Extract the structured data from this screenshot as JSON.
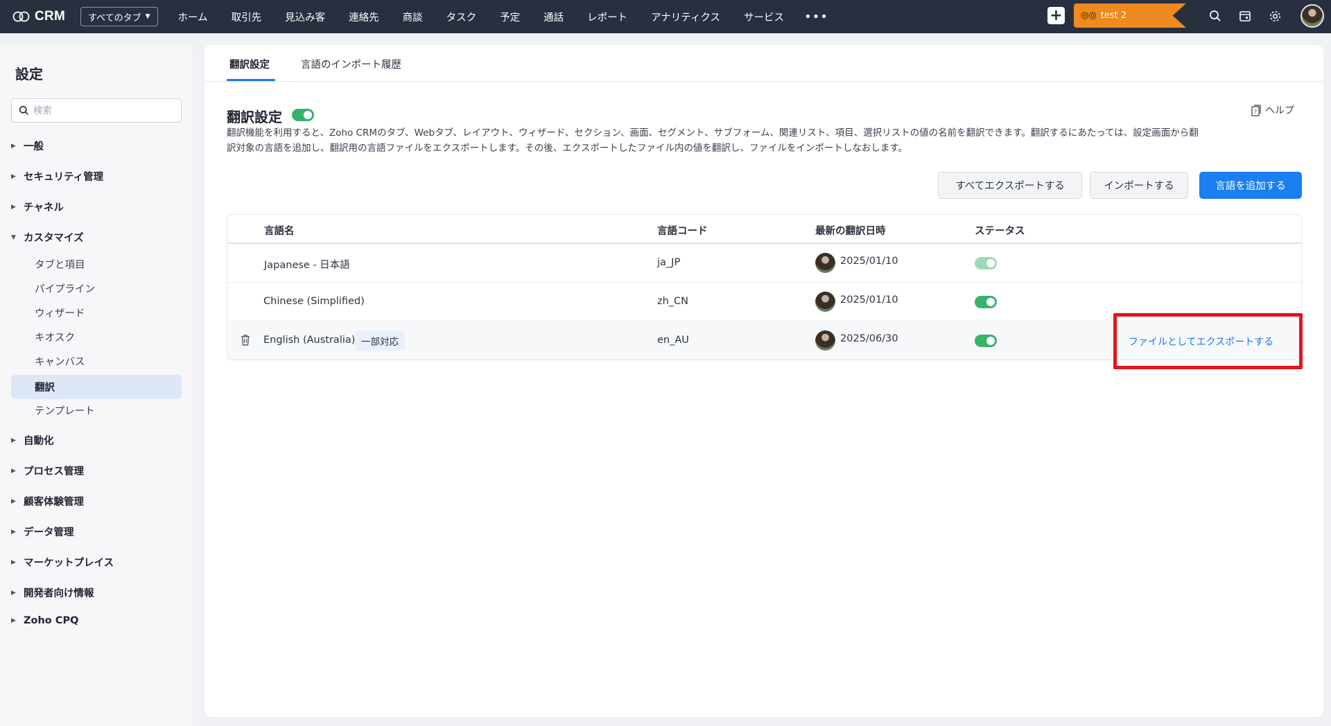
{
  "app": {
    "logo_text": "CRM",
    "tabs_dropdown": "すべてのタブ",
    "nav": [
      "ホーム",
      "取引先",
      "見込み客",
      "連絡先",
      "商談",
      "タスク",
      "予定",
      "通話",
      "レポート",
      "アナリティクス",
      "サービス"
    ],
    "more": "•••",
    "org_name": "test 2",
    "plus": "+"
  },
  "sidebar": {
    "title": "設定",
    "search_placeholder": "検索",
    "groups_top": [
      {
        "label": "一般",
        "expanded": false
      },
      {
        "label": "セキュリティ管理",
        "expanded": false
      },
      {
        "label": "チャネル",
        "expanded": false
      },
      {
        "label": "カスタマイズ",
        "expanded": true
      }
    ],
    "sub_items": [
      "タブと項目",
      "パイプライン",
      "ウィザード",
      "キオスク",
      "キャンバス",
      "翻訳",
      "テンプレート"
    ],
    "active_sub": "翻訳",
    "groups_bottom": [
      {
        "label": "自動化"
      },
      {
        "label": "プロセス管理"
      },
      {
        "label": "顧客体験管理"
      },
      {
        "label": "データ管理"
      },
      {
        "label": "マーケットプレイス"
      },
      {
        "label": "開発者向け情報"
      },
      {
        "label": "Zoho CPQ"
      }
    ]
  },
  "main": {
    "tabs": [
      "翻訳設定",
      "言語のインポート履歴"
    ],
    "active_tab": "翻訳設定",
    "title": "翻訳設定",
    "title_toggle_on": true,
    "help": "ヘルプ",
    "description_line1": "翻訳機能を利用すると、Zoho CRMのタブ、Webタブ、レイアウト、ウィザード、セクション、画面、セグメント、サブフォーム、関連リスト、項目、選択リストの値の名前を翻訳できます。翻訳するにあたっては、設定画面から翻",
    "description_line2": "訳対象の言語を追加し、翻訳用の言語ファイルをエクスポートします。その後、エクスポートしたファイル内の値を翻訳し、ファイルをインポートしなおします。",
    "buttons": {
      "export_all": "すべてエクスポートする",
      "import": "インポートする",
      "add_language": "言語を追加する"
    },
    "table": {
      "headers": [
        "言語名",
        "言語コード",
        "最新の翻訳日時",
        "ステータス"
      ],
      "rows": [
        {
          "name": "Japanese - 日本語",
          "code": "ja_JP",
          "date": "2025/01/10",
          "status_on": true,
          "status_disabled": true,
          "badge": "",
          "action": ""
        },
        {
          "name": "Chinese (Simplified)",
          "code": "zh_CN",
          "date": "2025/01/10",
          "status_on": true,
          "status_disabled": false,
          "badge": "",
          "action": ""
        },
        {
          "name": "English (Australia)",
          "code": "en_AU",
          "date": "2025/06/30",
          "status_on": true,
          "status_disabled": false,
          "badge": "一部対応",
          "action": "ファイルとしてエクスポートする"
        }
      ]
    }
  },
  "colors": {
    "topbar": "#283040",
    "accent": "#1a7ff0",
    "toggle_on": "#37b36b",
    "org_badge": "#ee8a1e",
    "highlight": "#e5151d"
  }
}
